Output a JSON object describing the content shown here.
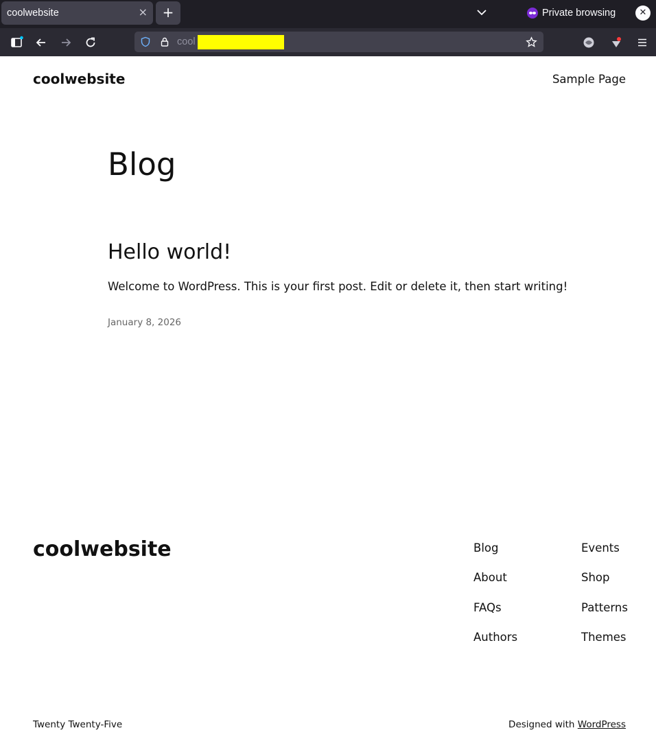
{
  "browser": {
    "tab_title": "coolwebsite",
    "tab_close": "×",
    "new_tab": "+",
    "private_label": "Private browsing",
    "close_window": "✕",
    "url_prefix": "cool",
    "icons": [
      "sidebar-icon",
      "back-icon",
      "forward-icon",
      "reload-icon",
      "shield-icon",
      "lock-icon",
      "bookmark-star-icon",
      "extension-icon",
      "extension-icon-2",
      "menu-icon",
      "tab-list-icon",
      "private-browsing-icon"
    ]
  },
  "header": {
    "site_title": "coolwebsite",
    "nav_link": "Sample Page"
  },
  "main": {
    "heading": "Blog",
    "post": {
      "title": "Hello world!",
      "excerpt": "Welcome to WordPress. This is your first post. Edit or delete it, then start writing!",
      "date": "January 8, 2026"
    }
  },
  "footer": {
    "site_title": "coolwebsite",
    "col1": [
      "Blog",
      "About",
      "FAQs",
      "Authors"
    ],
    "col2": [
      "Events",
      "Shop",
      "Patterns",
      "Themes"
    ],
    "theme_credit": "Twenty Twenty-Five",
    "designed_with": "Designed with ",
    "wordpress_link": "WordPress"
  }
}
